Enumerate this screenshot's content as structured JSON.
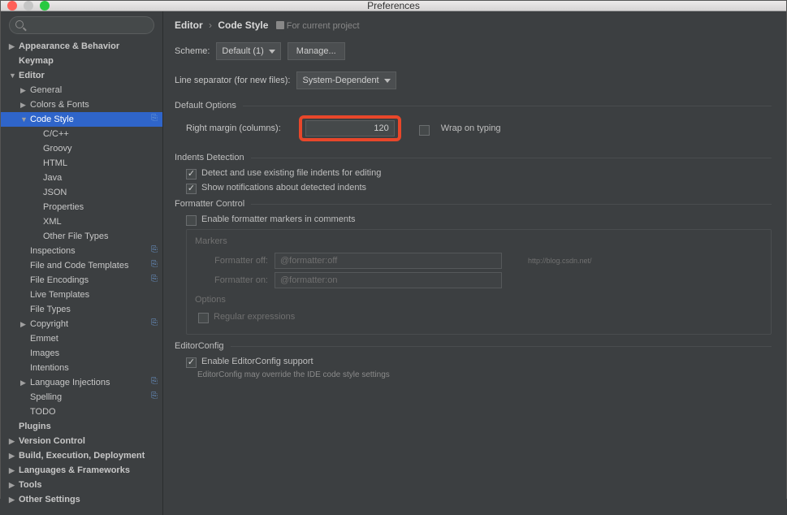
{
  "window": {
    "title": "Preferences"
  },
  "search": {
    "placeholder": ""
  },
  "sidebar": {
    "items": [
      {
        "label": "Appearance & Behavior",
        "arrow": "▶",
        "bold": true,
        "indent": 0
      },
      {
        "label": "Keymap",
        "arrow": "",
        "bold": true,
        "indent": 0
      },
      {
        "label": "Editor",
        "arrow": "▼",
        "bold": true,
        "indent": 0
      },
      {
        "label": "General",
        "arrow": "▶",
        "bold": false,
        "indent": 1
      },
      {
        "label": "Colors & Fonts",
        "arrow": "▶",
        "bold": false,
        "indent": 1
      },
      {
        "label": "Code Style",
        "arrow": "▼",
        "bold": false,
        "indent": 1,
        "selected": true,
        "badge": "⎘"
      },
      {
        "label": "C/C++",
        "arrow": "",
        "bold": false,
        "indent": 2
      },
      {
        "label": "Groovy",
        "arrow": "",
        "bold": false,
        "indent": 2
      },
      {
        "label": "HTML",
        "arrow": "",
        "bold": false,
        "indent": 2
      },
      {
        "label": "Java",
        "arrow": "",
        "bold": false,
        "indent": 2
      },
      {
        "label": "JSON",
        "arrow": "",
        "bold": false,
        "indent": 2
      },
      {
        "label": "Properties",
        "arrow": "",
        "bold": false,
        "indent": 2
      },
      {
        "label": "XML",
        "arrow": "",
        "bold": false,
        "indent": 2
      },
      {
        "label": "Other File Types",
        "arrow": "",
        "bold": false,
        "indent": 2
      },
      {
        "label": "Inspections",
        "arrow": "",
        "bold": false,
        "indent": 1,
        "badge": "⎘"
      },
      {
        "label": "File and Code Templates",
        "arrow": "",
        "bold": false,
        "indent": 1,
        "badge": "⎘"
      },
      {
        "label": "File Encodings",
        "arrow": "",
        "bold": false,
        "indent": 1,
        "badge": "⎘"
      },
      {
        "label": "Live Templates",
        "arrow": "",
        "bold": false,
        "indent": 1
      },
      {
        "label": "File Types",
        "arrow": "",
        "bold": false,
        "indent": 1
      },
      {
        "label": "Copyright",
        "arrow": "▶",
        "bold": false,
        "indent": 1,
        "badge": "⎘"
      },
      {
        "label": "Emmet",
        "arrow": "",
        "bold": false,
        "indent": 1
      },
      {
        "label": "Images",
        "arrow": "",
        "bold": false,
        "indent": 1
      },
      {
        "label": "Intentions",
        "arrow": "",
        "bold": false,
        "indent": 1
      },
      {
        "label": "Language Injections",
        "arrow": "▶",
        "bold": false,
        "indent": 1,
        "badge": "⎘"
      },
      {
        "label": "Spelling",
        "arrow": "",
        "bold": false,
        "indent": 1,
        "badge": "⎘"
      },
      {
        "label": "TODO",
        "arrow": "",
        "bold": false,
        "indent": 1
      },
      {
        "label": "Plugins",
        "arrow": "",
        "bold": true,
        "indent": 0
      },
      {
        "label": "Version Control",
        "arrow": "▶",
        "bold": true,
        "indent": 0
      },
      {
        "label": "Build, Execution, Deployment",
        "arrow": "▶",
        "bold": true,
        "indent": 0
      },
      {
        "label": "Languages & Frameworks",
        "arrow": "▶",
        "bold": true,
        "indent": 0
      },
      {
        "label": "Tools",
        "arrow": "▶",
        "bold": true,
        "indent": 0
      },
      {
        "label": "Other Settings",
        "arrow": "▶",
        "bold": true,
        "indent": 0
      }
    ]
  },
  "breadcrumb": {
    "a": "Editor",
    "b": "Code Style",
    "scope": "For current project"
  },
  "scheme": {
    "label": "Scheme:",
    "value": "Default (1)",
    "manage": "Manage..."
  },
  "lineSep": {
    "label": "Line separator (for new files):",
    "value": "System-Dependent"
  },
  "defaultOptions": {
    "title": "Default Options",
    "rightMarginLabel": "Right margin (columns):",
    "rightMarginValue": "120",
    "wrapOnTyping": "Wrap on typing"
  },
  "indents": {
    "title": "Indents Detection",
    "detect": "Detect and use existing file indents for editing",
    "notify": "Show notifications about detected indents"
  },
  "formatter": {
    "title": "Formatter Control",
    "enable": "Enable formatter markers in comments",
    "markersTitle": "Markers",
    "offLabel": "Formatter off:",
    "offValue": "@formatter:off",
    "offHint": "http://blog.csdn.net/",
    "onLabel": "Formatter on:",
    "onValue": "@formatter:on",
    "optionsTitle": "Options",
    "regex": "Regular expressions"
  },
  "editorconfig": {
    "title": "EditorConfig",
    "enable": "Enable EditorConfig support",
    "hint": "EditorConfig may override the IDE code style settings"
  }
}
